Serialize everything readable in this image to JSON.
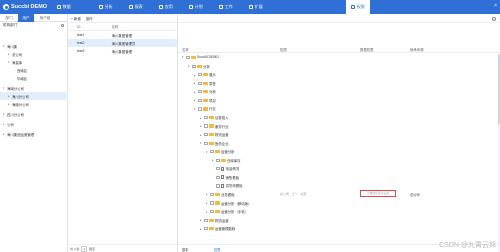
{
  "app": {
    "title": "Succbi DEMO"
  },
  "nav": {
    "items": [
      {
        "label": "数据",
        "icon": "database-icon",
        "active": false
      },
      {
        "label": "分析",
        "icon": "chart-icon",
        "active": false
      },
      {
        "label": "报表",
        "icon": "report-icon",
        "active": false
      },
      {
        "label": "应用",
        "icon": "app-icon",
        "active": false
      },
      {
        "label": "计划",
        "icon": "calendar-icon",
        "active": false
      },
      {
        "label": "工作",
        "icon": "work-icon",
        "active": false
      },
      {
        "label": "扩展",
        "icon": "extension-icon",
        "active": false
      },
      {
        "label": "权限",
        "icon": "lock-icon",
        "active": true
      }
    ]
  },
  "left": {
    "tabs": [
      {
        "label": "部门",
        "active": false
      },
      {
        "label": "用户",
        "active": true
      },
      {
        "label": "用户组",
        "active": false
      }
    ],
    "header": "机构部门",
    "tree": [
      {
        "label": "海川集",
        "level": 0,
        "expanded": true,
        "selected": false
      },
      {
        "label": "总公司",
        "level": 1,
        "expanded": false,
        "selected": false
      },
      {
        "label": "海量库",
        "level": 1,
        "expanded": true,
        "selected": false
      },
      {
        "label": "西南区",
        "level": 2,
        "expanded": null,
        "selected": false
      },
      {
        "label": "华南区",
        "level": 2,
        "expanded": null,
        "selected": false
      },
      {
        "label": "海南分公司",
        "level": 0,
        "expanded": true,
        "selected": false
      },
      {
        "label": "海川分公司",
        "level": 1,
        "expanded": false,
        "selected": true
      },
      {
        "label": "海南分公司",
        "level": 1,
        "expanded": false,
        "selected": false
      },
      {
        "label": "四川分公司",
        "level": 0,
        "expanded": false,
        "selected": false
      },
      {
        "label": "公司",
        "level": 0,
        "expanded": false,
        "selected": false
      },
      {
        "label": "海川集团运营管理",
        "level": 0,
        "expanded": false,
        "selected": false
      }
    ]
  },
  "middle": {
    "toolbar": {
      "add_label": "+ 新增",
      "action_label": "操作"
    },
    "columns": [
      "ID",
      "名称"
    ],
    "rows": [
      {
        "id": "test1",
        "name": "海川集团管理",
        "selected": false
      },
      {
        "id": "test2",
        "name": "海川集团管理员",
        "selected": true
      },
      {
        "id": "test3",
        "name": "海川集团管理",
        "selected": false
      }
    ],
    "footer": {
      "prefix": "共 3 条",
      "page": "1",
      "suffix": "跳至"
    }
  },
  "right": {
    "columns": [
      "名称",
      "权限",
      "数据权限",
      "继承来源"
    ],
    "rows": [
      {
        "label": "SuccBI DEMO",
        "indent": 0,
        "arrow": "▾",
        "icon": "folder"
      },
      {
        "label": "分析",
        "indent": 1,
        "arrow": "▾",
        "icon": "folder"
      },
      {
        "label": "展示",
        "indent": 2,
        "arrow": "▸",
        "icon": "folder"
      },
      {
        "label": "零售",
        "indent": 2,
        "arrow": "▸",
        "icon": "folder"
      },
      {
        "label": "分析",
        "indent": 2,
        "arrow": "▸",
        "icon": "folder"
      },
      {
        "label": "项目",
        "indent": 2,
        "arrow": "▸",
        "icon": "folder"
      },
      {
        "label": "行业",
        "indent": 2,
        "arrow": "▾",
        "icon": "folder"
      },
      {
        "label": "证券投入",
        "indent": 3,
        "arrow": "▸",
        "icon": "folder"
      },
      {
        "label": "服务行业",
        "indent": 3,
        "arrow": "▸",
        "icon": "folder"
      },
      {
        "label": "物流运营",
        "indent": 3,
        "arrow": "▸",
        "icon": "folder"
      },
      {
        "label": "医药企业",
        "indent": 3,
        "arrow": "▾",
        "icon": "folder"
      },
      {
        "label": "运营分析",
        "indent": 4,
        "arrow": "▾",
        "icon": "folder"
      },
      {
        "label": "仓库库存",
        "indent": 5,
        "arrow": "▸",
        "icon": "folder"
      },
      {
        "label": "电话情况",
        "indent": 5,
        "arrow": "",
        "icon": "file"
      },
      {
        "label": "销售看板",
        "indent": 5,
        "arrow": "",
        "icon": "file"
      },
      {
        "label": "供货商看板",
        "indent": 5,
        "arrow": "",
        "icon": "file"
      },
      {
        "label": "业务看板",
        "indent": 4,
        "arrow": "▸",
        "icon": "folder",
        "extra": true
      },
      {
        "label": "运营分析（移动版）",
        "indent": 4,
        "arrow": "▸",
        "icon": "folder"
      },
      {
        "label": "运营分析（手机）",
        "indent": 4,
        "arrow": "▸",
        "icon": "folder"
      },
      {
        "label": "物流运营",
        "indent": 3,
        "arrow": "▸",
        "icon": "folder"
      },
      {
        "label": "运营管理能耗",
        "indent": 3,
        "arrow": "▸",
        "icon": "folder"
      }
    ],
    "extra_row": {
      "address": "总公司 · 上一 · 北京",
      "data_permission_placeholder": "无数据权限请设置",
      "inherit_source": "总公司"
    },
    "footer": {
      "left": "基本",
      "right": "权限"
    }
  },
  "watermark": "CSDN @九霄云邦"
}
